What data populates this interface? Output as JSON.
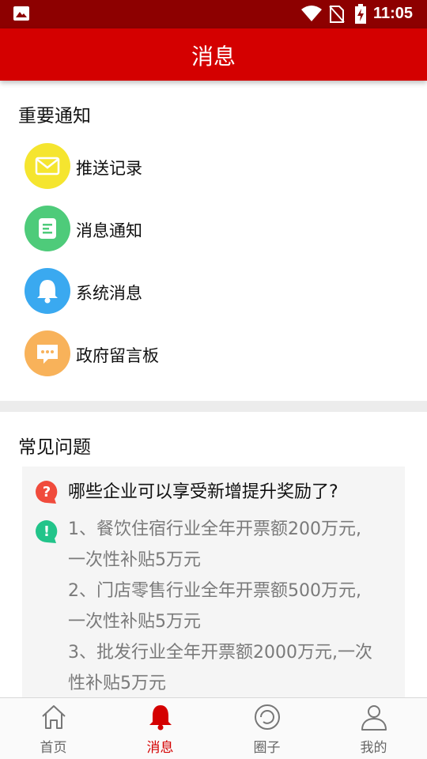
{
  "status_bar": {
    "time": "11:05"
  },
  "header": {
    "title": "消息"
  },
  "notices": {
    "title": "重要通知",
    "items": [
      {
        "label": "推送记录",
        "icon": "mail-icon",
        "color": "#f5e52f"
      },
      {
        "label": "消息通知",
        "icon": "document-icon",
        "color": "#4ecb7a"
      },
      {
        "label": "系统消息",
        "icon": "bell-icon",
        "color": "#3aa9f0"
      },
      {
        "label": "政府留言板",
        "icon": "chat-icon",
        "color": "#f8b25a"
      }
    ]
  },
  "faq": {
    "title": "常见问题",
    "question": "哪些企业可以享受新增提升奖励了?",
    "answer": "1、餐饮住宿行业全年开票额200万元,一次性补贴5万元 2、门店零售行业全年开票额500万元,一次性补贴5万元 3、批发行业全年开票额2000万元,一次性补贴5万元",
    "answer_lines": [
      "1、餐饮住宿行业全年开票额200万元,",
      "一次性补贴5万元",
      "2、门店零售行业全年开票额500万元,",
      "一次性补贴5万元",
      "3、批发行业全年开票额2000万元,一次",
      "性补贴5万元"
    ]
  },
  "nav": {
    "tabs": [
      {
        "label": "首页",
        "icon": "home-icon"
      },
      {
        "label": "消息",
        "icon": "bell-icon",
        "active": true
      },
      {
        "label": "圈子",
        "icon": "circle-icon"
      },
      {
        "label": "我的",
        "icon": "user-icon"
      }
    ]
  },
  "colors": {
    "brand": "#d40000",
    "status_bar": "#8d0000"
  }
}
